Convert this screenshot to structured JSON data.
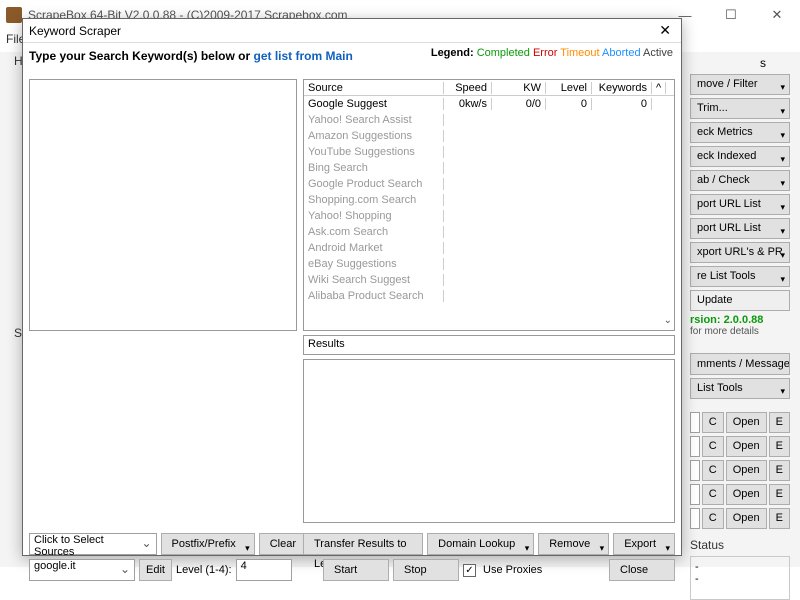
{
  "window": {
    "title": "ScrapeBox 64-Bit V2.0.0.88 - (C)2009-2017 Scrapebox.com",
    "menu_file": "File",
    "btn_min": "—",
    "btn_max": "☐",
    "btn_close": "✕"
  },
  "bg": {
    "frag_h": "H",
    "frag_s": "S"
  },
  "right": {
    "btn_rf": "move / Filter",
    "btn_trim": "Trim...",
    "btn_metrics": "eck Metrics",
    "btn_indexed": "eck Indexed",
    "btn_grabcheck": "ab / Check",
    "btn_porturllist": "port URL List",
    "btn_porturllist2": "port URL List",
    "btn_pagerank": "xport URL's & PR",
    "btn_listtools": "re List Tools",
    "btn_update": "Update",
    "version": "rsion:  2.0.0.88",
    "details": "for more details",
    "sec_comments": "mments / Messages",
    "btn_listtools2": "List Tools",
    "btn_c": "C",
    "btn_open": "Open",
    "btn_e": "E",
    "sec_status": "Status",
    "status_dash1": "-",
    "status_dash2": "-"
  },
  "dialog": {
    "title": "Keyword Scraper",
    "close": "✕",
    "prompt_prefix": "Type your Search Keyword(s) below or ",
    "prompt_link": "get list from Main",
    "legend_label": "Legend:",
    "legend_items": [
      "Completed",
      "Error",
      "Timeout",
      "Aborted",
      "Active"
    ],
    "cols": {
      "source": "Source",
      "speed": "Speed",
      "kw": "KW",
      "level": "Level",
      "keywords": "Keywords",
      "scr": "^"
    },
    "rows": [
      {
        "source": "Google Suggest",
        "speed": "0kw/s",
        "kw": "0/0",
        "level": "0",
        "keywords": "0"
      },
      {
        "source": "Yahoo! Search Assist",
        "speed": "",
        "kw": "",
        "level": "",
        "keywords": ""
      },
      {
        "source": "Amazon Suggestions",
        "speed": "",
        "kw": "",
        "level": "",
        "keywords": ""
      },
      {
        "source": "YouTube Suggestions",
        "speed": "",
        "kw": "",
        "level": "",
        "keywords": ""
      },
      {
        "source": "Bing Search",
        "speed": "",
        "kw": "",
        "level": "",
        "keywords": ""
      },
      {
        "source": "Google Product Search",
        "speed": "",
        "kw": "",
        "level": "",
        "keywords": ""
      },
      {
        "source": "Shopping.com Search",
        "speed": "",
        "kw": "",
        "level": "",
        "keywords": ""
      },
      {
        "source": "Yahoo! Shopping",
        "speed": "",
        "kw": "",
        "level": "",
        "keywords": ""
      },
      {
        "source": "Ask.com Search",
        "speed": "",
        "kw": "",
        "level": "",
        "keywords": ""
      },
      {
        "source": "Android Market",
        "speed": "",
        "kw": "",
        "level": "",
        "keywords": ""
      },
      {
        "source": "eBay Suggestions",
        "speed": "",
        "kw": "",
        "level": "",
        "keywords": ""
      },
      {
        "source": "Wiki Search Suggest",
        "speed": "",
        "kw": "",
        "level": "",
        "keywords": ""
      },
      {
        "source": "Alibaba Product Search",
        "speed": "",
        "kw": "",
        "level": "",
        "keywords": ""
      }
    ],
    "scroll_down": "⌄",
    "results_label": "Results",
    "select_sources": "Click to Select Sources",
    "postfix": "Postfix/Prefix",
    "clear": "Clear",
    "transfer": "Transfer Results to Left Side",
    "domain_lookup": "Domain Lookup",
    "remove": "Remove",
    "export": "Export",
    "tld": "google.it",
    "edit": "Edit",
    "level_label": "Level (1-4):",
    "level_value": "4",
    "start": "Start",
    "stop": "Stop",
    "use_proxies_chk": "✓",
    "use_proxies": "Use Proxies",
    "close_btn": "Close"
  }
}
